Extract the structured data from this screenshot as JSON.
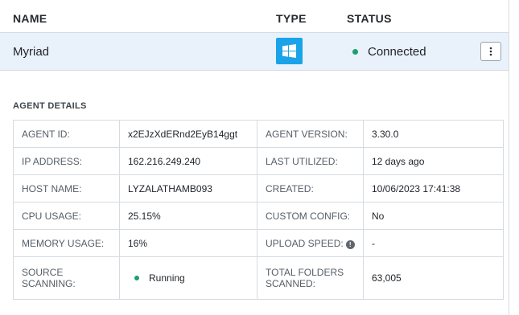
{
  "columns": {
    "name": "NAME",
    "type": "TYPE",
    "status": "STATUS"
  },
  "agent": {
    "name": "Myriad",
    "type_icon": "windows-logo-icon",
    "status": "Connected",
    "status_color": "#1e9e6a",
    "type_color": "#1aa3e8",
    "row_highlight": "#e9f1fb"
  },
  "details": {
    "title": "AGENT DETAILS",
    "rows": [
      {
        "l1": "AGENT ID:",
        "v1": "x2EJzXdERnd2EyB14ggt",
        "l2": "AGENT VERSION:",
        "v2": "3.30.0"
      },
      {
        "l1": "IP ADDRESS:",
        "v1": "162.216.249.240",
        "l2": "LAST UTILIZED:",
        "v2": "12 days ago"
      },
      {
        "l1": "HOST NAME:",
        "v1": "LYZALATHAMB093",
        "l2": "CREATED:",
        "v2": "10/06/2023 17:41:38"
      },
      {
        "l1": "CPU USAGE:",
        "v1": "25.15%",
        "l2": "CUSTOM CONFIG:",
        "v2": "No"
      },
      {
        "l1": "MEMORY USAGE:",
        "v1": "16%",
        "l2": "UPLOAD SPEED:",
        "v2": "-"
      },
      {
        "l1": "SOURCE SCANNING:",
        "v1": "Running",
        "l2a": "TOTAL FOLDERS",
        "l2b": "SCANNED:",
        "v2": "63,005"
      }
    ]
  }
}
